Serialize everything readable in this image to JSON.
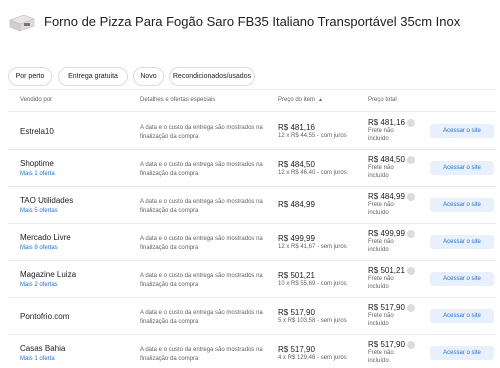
{
  "product": {
    "title": "Forno de Pizza Para Fogão Saro FB35 Italiano Transportável 35cm Inox"
  },
  "filters": [
    {
      "label": "Por perto"
    },
    {
      "label": "Entrega gratuita"
    },
    {
      "label": "Novo"
    },
    {
      "label": "Recondicionados/usados"
    }
  ],
  "table": {
    "headers": {
      "seller": "Vendido por",
      "details": "Detalhes e ofertas especiais",
      "item_price": "Preço do item",
      "total_price": "Preço total"
    },
    "rows": [
      {
        "seller": "Estrela10",
        "more": "",
        "details": "A data e o custo da entrega são mostrados na finalização da compra",
        "price": "R$ 481,16",
        "installment": "12 x R$ 44,55 - com juros",
        "total": "R$ 481,16",
        "frete": "Frete não incluído",
        "button": "Acessar o site"
      },
      {
        "seller": "Shoptime",
        "more": "Mais 1 oferta",
        "details": "A data e o custo da entrega são mostrados na finalização da compra",
        "price": "R$ 484,50",
        "installment": "12 x R$ 46,40 - com juros",
        "total": "R$ 484,50",
        "frete": "Frete não incluído",
        "button": "Acessar o site"
      },
      {
        "seller": "TAO Utilidades",
        "more": "Mais 5 ofertas",
        "details": "A data e o custo da entrega são mostrados na finalização da compra",
        "price": "R$ 484,99",
        "installment": "",
        "total": "R$ 484,99",
        "frete": "Frete não incluído",
        "button": "Acessar o site"
      },
      {
        "seller": "Mercado Livre",
        "more": "Mais 9 ofertas",
        "details": "A data e o custo da entrega são mostrados na finalização da compra",
        "price": "R$ 499,99",
        "installment": "12 x R$ 41,67 - sem juros",
        "total": "R$ 499,99",
        "frete": "Frete não incluído",
        "button": "Acessar o site"
      },
      {
        "seller": "Magazine Luiza",
        "more": "Mais 2 ofertas",
        "details": "A data e o custo da entrega são mostrados na finalização da compra",
        "price": "R$ 501,21",
        "installment": "10 x R$ 55,69 - com juros",
        "total": "R$ 501,21",
        "frete": "Frete não incluído",
        "button": "Acessar o site"
      },
      {
        "seller": "Pontofrio.com",
        "more": "",
        "details": "A data e o custo da entrega são mostrados na finalização da compra",
        "price": "R$ 517,90",
        "installment": "5 x R$ 103,58 - sem juros",
        "total": "R$ 517,90",
        "frete": "Frete não incluído",
        "button": "Acessar o site"
      },
      {
        "seller": "Casas Bahia",
        "more": "Mais 1 oferta",
        "details": "A data e o custo da entrega são mostrados na finalização da compra",
        "price": "R$ 517,90",
        "installment": "4 x R$ 129,48 - sem juros",
        "total": "R$ 517,90",
        "frete": "Frete não incluído",
        "button": "Acessar o site"
      }
    ]
  }
}
